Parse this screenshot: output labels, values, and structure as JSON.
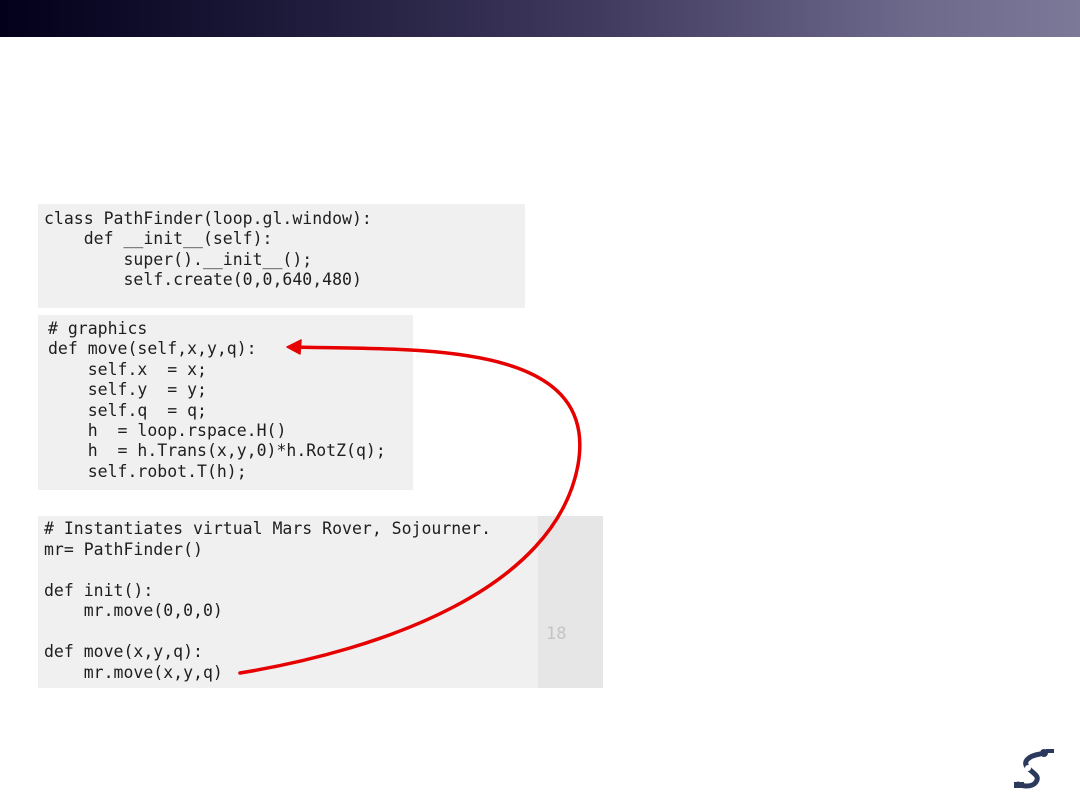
{
  "slide": {
    "colors": {
      "bar_dark": "#02001a",
      "bar_light": "#7b7898",
      "arrow": "#e60000",
      "code_bg": "#f0f0f0",
      "logo": "#2b3a5c"
    },
    "logo_icon": "robot-arm-icon"
  },
  "code": {
    "class_block": "class PathFinder(loop.gl.window):\n    def __init__(self):\n        super().__init__();\n        self.create(0,0,640,480)",
    "graphics_block": "# graphics\ndef move(self,x,y,q):\n    self.x  = x;\n    self.y  = y;\n    self.q  = q;\n    h  = loop.rspace.H()\n    h  = h.Trans(x,y,0)*h.RotZ(q);\n    self.robot.T(h);",
    "main_block": "# Instantiates virtual Mars Rover, Sojourner.\nmr= PathFinder()\n\ndef init():\n    mr.move(0,0,0)\n\ndef move(x,y,q):\n    mr.move(x,y,q)",
    "faint_number": "18"
  }
}
